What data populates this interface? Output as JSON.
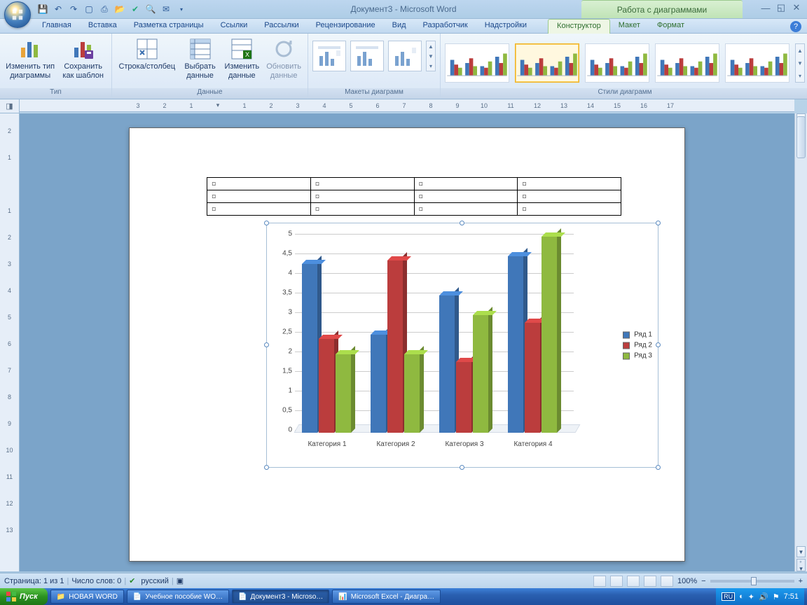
{
  "window": {
    "title_doc": "Документ3 - Microsoft Word",
    "context_title": "Работа с диаграммами"
  },
  "qat": [
    "save",
    "undo",
    "redo",
    "new",
    "quickprint",
    "open",
    "spelling",
    "preview",
    "email"
  ],
  "tabs": {
    "items": [
      "Главная",
      "Вставка",
      "Разметка страницы",
      "Ссылки",
      "Рассылки",
      "Рецензирование",
      "Вид",
      "Разработчик",
      "Надстройки"
    ],
    "context_items": [
      "Конструктор",
      "Макет",
      "Формат"
    ],
    "active_context": "Конструктор"
  },
  "ribbon": {
    "type": {
      "label": "Тип",
      "buttons": {
        "change_type": "Изменить тип\nдиаграммы",
        "save_template": "Сохранить\nкак шаблон"
      }
    },
    "data": {
      "label": "Данные",
      "buttons": {
        "switch": "Строка/столбец",
        "select": "Выбрать\nданные",
        "edit": "Изменить\nданные",
        "refresh": "Обновить\nданные"
      }
    },
    "layouts": {
      "label": "Макеты диаграмм"
    },
    "styles": {
      "label": "Стили диаграмм"
    }
  },
  "document": {
    "table": {
      "rows": 3,
      "cols": 4,
      "cell_marker": "¤"
    }
  },
  "chart_data": {
    "type": "bar",
    "categories": [
      "Категория 1",
      "Категория 2",
      "Категория 3",
      "Категория 4"
    ],
    "series": [
      {
        "name": "Ряд 1",
        "color": "#4077b9",
        "values": [
          4.3,
          2.5,
          3.5,
          4.5
        ]
      },
      {
        "name": "Ряд 2",
        "color": "#bb3d3d",
        "values": [
          2.4,
          4.4,
          1.8,
          2.8
        ]
      },
      {
        "name": "Ряд 3",
        "color": "#8fb940",
        "values": [
          2.0,
          2.0,
          3.0,
          5.0
        ]
      }
    ],
    "ylim": [
      0,
      5
    ],
    "ystep": 0.5,
    "yticks": [
      "0",
      "0,5",
      "1",
      "1,5",
      "2",
      "2,5",
      "3",
      "3,5",
      "4",
      "4,5",
      "5"
    ]
  },
  "statusbar": {
    "page": "Страница: 1 из 1",
    "words": "Число слов: 0",
    "lang": "русский",
    "zoom": "100%"
  },
  "taskbar": {
    "start": "Пуск",
    "items": [
      {
        "label": "НОВАЯ WORD",
        "icon": "folder"
      },
      {
        "label": "Учебное пособие WO…",
        "icon": "word"
      },
      {
        "label": "Документ3 - Microso…",
        "icon": "word",
        "active": true
      },
      {
        "label": "Microsoft Excel - Диагра…",
        "icon": "excel"
      }
    ],
    "clock": "7:51",
    "lang": "RU"
  }
}
